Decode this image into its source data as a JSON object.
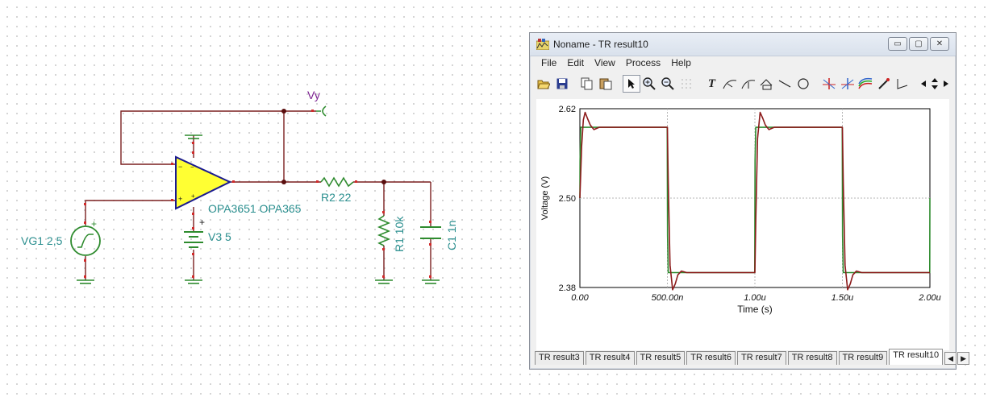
{
  "schematic": {
    "vy_label": "Vy",
    "opamp_label": "OPA3651 OPA365",
    "r2_label": "R2 22",
    "r1_label": "R1 10k",
    "c1_label": "C1 1n",
    "vg1_label": "VG1 2,5",
    "v3_label": "V3 5",
    "plus_sign": "+",
    "minus_sign": "−"
  },
  "window": {
    "title": "Noname - TR result10",
    "minimize": "▭",
    "maximize": "▢",
    "close": "✕"
  },
  "menu": [
    "File",
    "Edit",
    "View",
    "Process",
    "Help"
  ],
  "toolbar": {
    "icons": [
      "open-icon",
      "save-icon",
      "copy-icon",
      "paste-icon",
      "pointer-icon",
      "zoom-in-icon",
      "zoom-out-icon",
      "grid-icon",
      "text-icon",
      "curve-label-icon",
      "curve-label2-icon",
      "axis-label-icon",
      "line-icon",
      "circle-icon",
      "cursor-a-icon",
      "cursor-b-icon",
      "color-icon",
      "probe-icon",
      "marker-icon",
      "scroll-left-icon",
      "scroll-updown-icon",
      "scroll-right-icon"
    ],
    "text_glyph": "T"
  },
  "chart_data": {
    "type": "line",
    "xlabel": "Time (s)",
    "ylabel": "Voltage (V)",
    "xlim": [
      0,
      2e-06
    ],
    "ylim": [
      2.38,
      2.62
    ],
    "x_ticks": [
      {
        "value": 0,
        "label": "0.00"
      },
      {
        "value": 5e-07,
        "label": "500.00n"
      },
      {
        "value": 1e-06,
        "label": "1.00u"
      },
      {
        "value": 1.5e-06,
        "label": "1.50u"
      },
      {
        "value": 2e-06,
        "label": "2.00u"
      }
    ],
    "y_ticks": [
      {
        "value": 2.62,
        "label": "2.62"
      },
      {
        "value": 2.5,
        "label": "2.50"
      },
      {
        "value": 2.38,
        "label": "2.38"
      }
    ],
    "grid": true,
    "series": [
      {
        "color": "#2e8b2e",
        "x": [
          0,
          1e-09,
          5e-09,
          4.99e-07,
          5.01e-07,
          5.05e-07,
          9.99e-07,
          1.001e-06,
          1.005e-06,
          1.499e-06,
          1.501e-06,
          1.505e-06,
          1.999e-06,
          2e-06
        ],
        "y": [
          2.5,
          2.55,
          2.595,
          2.595,
          2.45,
          2.4,
          2.4,
          2.55,
          2.595,
          2.595,
          2.45,
          2.4,
          2.4,
          2.5
        ]
      },
      {
        "color": "#8b1a1a",
        "x": [
          0,
          1e-08,
          2e-08,
          3e-08,
          4.5e-08,
          6e-08,
          8e-08,
          1.1e-07,
          1.5e-07,
          5e-07,
          5.05e-07,
          5.15e-07,
          5.3e-07,
          5.45e-07,
          5.6e-07,
          5.8e-07,
          6.1e-07,
          6.5e-07,
          1e-06,
          1.005e-06,
          1.015e-06,
          1.03e-06,
          1.045e-06,
          1.06e-06,
          1.08e-06,
          1.11e-06,
          1.15e-06,
          1.5e-06,
          1.505e-06,
          1.515e-06,
          1.53e-06,
          1.545e-06,
          1.56e-06,
          1.58e-06,
          1.61e-06,
          1.65e-06,
          2e-06
        ],
        "y": [
          2.5,
          2.57,
          2.605,
          2.615,
          2.606,
          2.598,
          2.592,
          2.595,
          2.595,
          2.595,
          2.52,
          2.41,
          2.377,
          2.385,
          2.397,
          2.402,
          2.4,
          2.4,
          2.4,
          2.47,
          2.58,
          2.615,
          2.607,
          2.598,
          2.592,
          2.595,
          2.595,
          2.595,
          2.52,
          2.41,
          2.377,
          2.385,
          2.397,
          2.402,
          2.4,
          2.4,
          2.4
        ]
      }
    ]
  },
  "tabs": [
    {
      "label": "TR result3",
      "active": false
    },
    {
      "label": "TR result4",
      "active": false
    },
    {
      "label": "TR result5",
      "active": false
    },
    {
      "label": "TR result6",
      "active": false
    },
    {
      "label": "TR result7",
      "active": false
    },
    {
      "label": "TR result8",
      "active": false
    },
    {
      "label": "TR result9",
      "active": false
    },
    {
      "label": "TR result10",
      "active": true
    }
  ],
  "tab_arrows": {
    "left": "◀",
    "right": "▶"
  }
}
